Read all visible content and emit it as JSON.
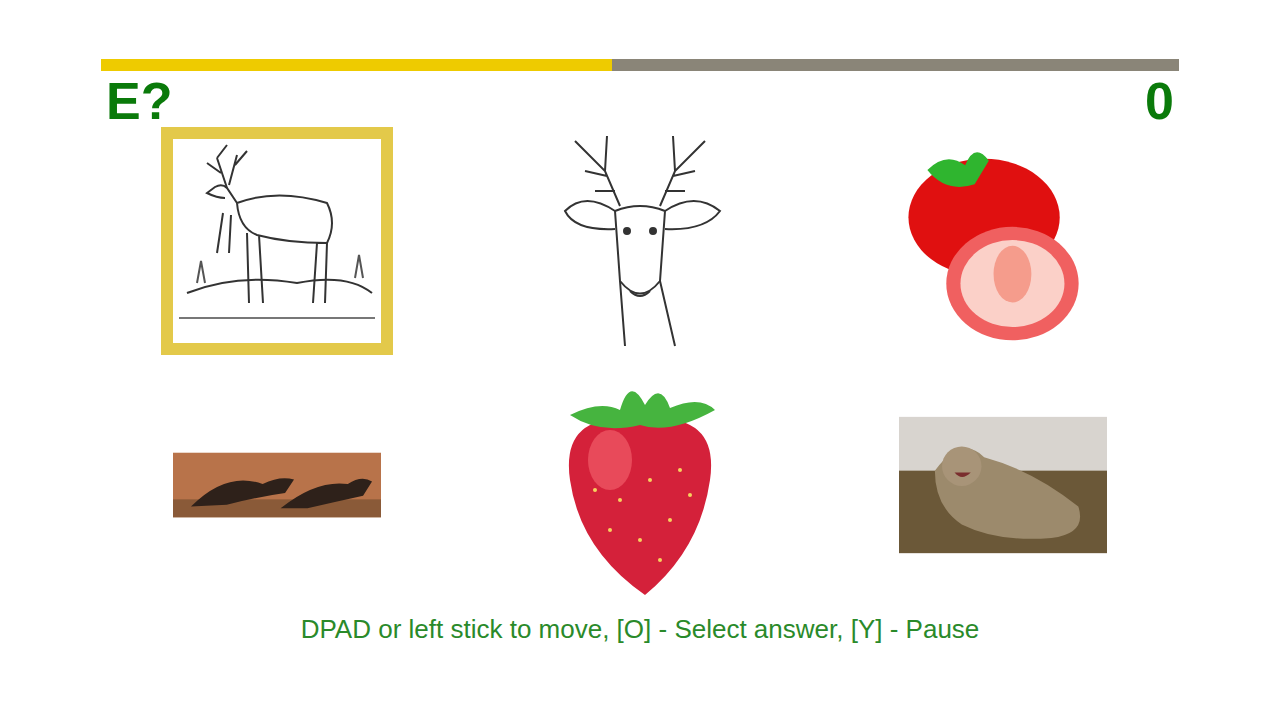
{
  "progress": {
    "level": 0.474
  },
  "level_label": "E?",
  "score": "0",
  "answers": [
    {
      "kind": "deer",
      "selected": true
    },
    {
      "kind": "stag",
      "selected": false
    },
    {
      "kind": "strawberries",
      "selected": false
    },
    {
      "kind": "otters",
      "selected": false
    },
    {
      "kind": "strawberry",
      "selected": false
    },
    {
      "kind": "bobcat",
      "selected": false
    }
  ],
  "hint": "DPAD or left stick to move, [O] - Select answer, [Y] - Pause"
}
